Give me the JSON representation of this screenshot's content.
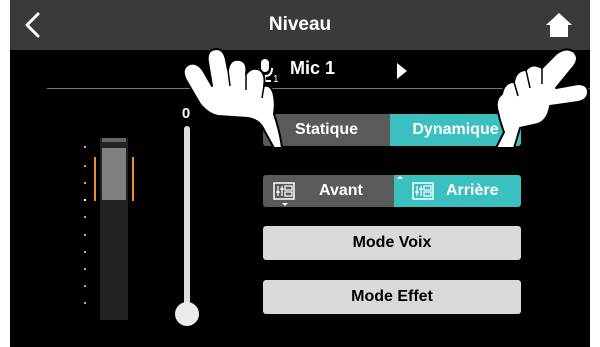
{
  "header": {
    "title": "Niveau"
  },
  "input": {
    "index": "1",
    "label": "Mic 1"
  },
  "fader": {
    "value": "0",
    "level": 0.0
  },
  "meter": {
    "level_fraction": 0.38
  },
  "dynamics_toggle": {
    "left_label": "Statique",
    "right_label": "Dynamique",
    "selected": "right"
  },
  "position_toggle": {
    "left_label": "Avant",
    "right_label": "Arrière",
    "selected": "right"
  },
  "buttons": {
    "voice_mode": "Mode Voix",
    "effect_mode": "Mode Effet"
  },
  "colors": {
    "accent": "#3bbfbf",
    "meter_marker": "#f08c28",
    "header_bg": "#3a3a3a"
  }
}
